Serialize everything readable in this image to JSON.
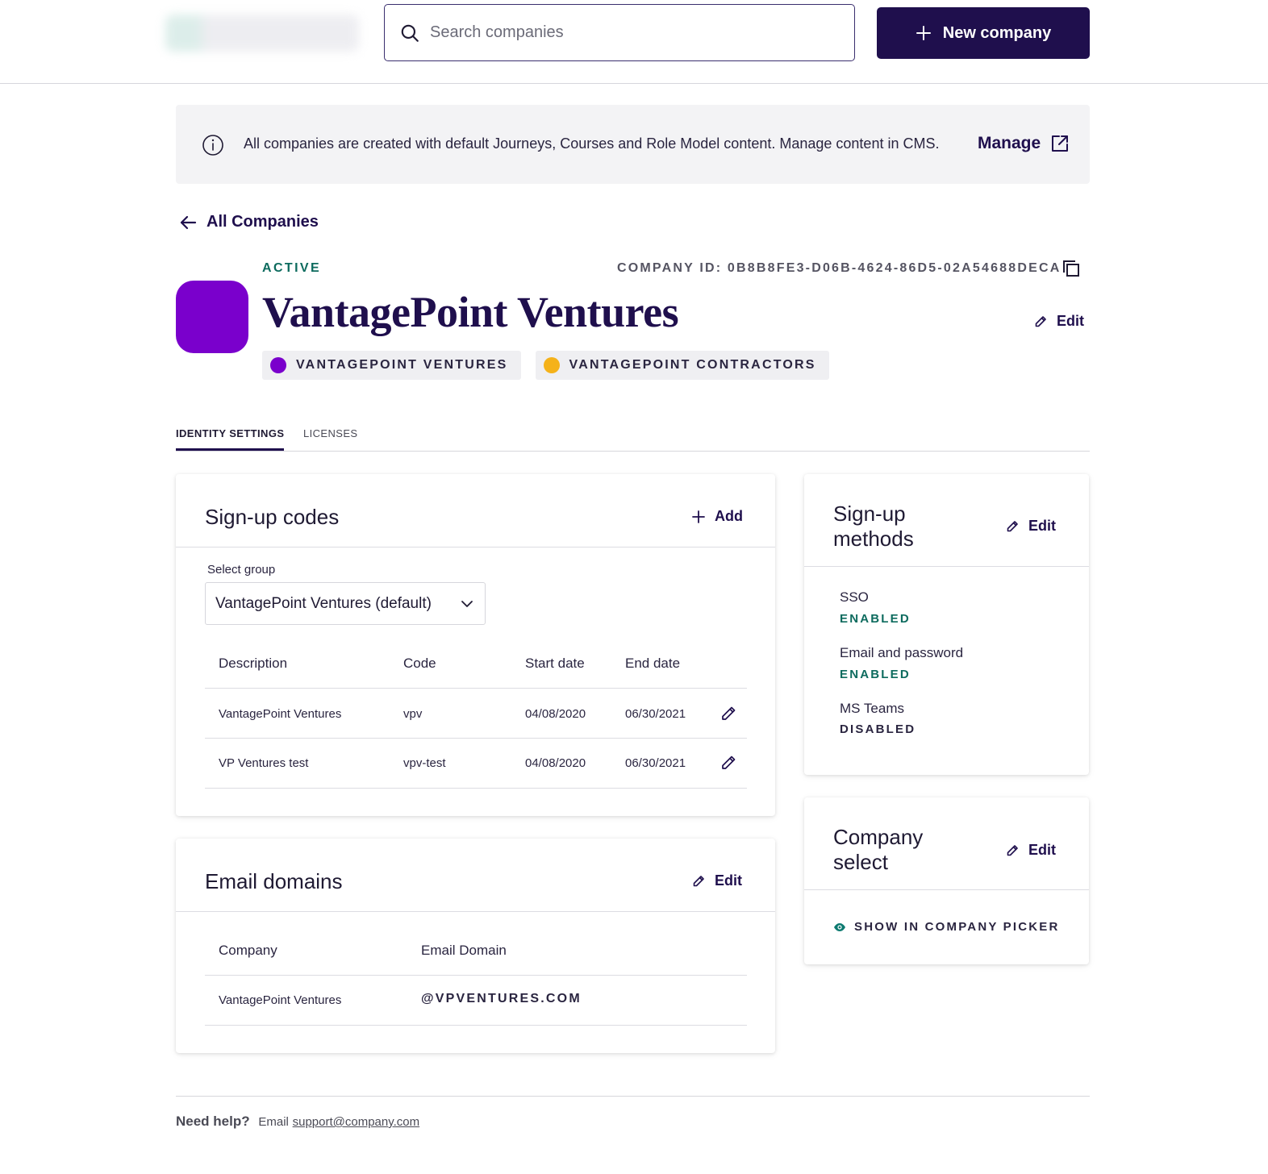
{
  "header": {
    "search_placeholder": "Search companies",
    "new_company_label": "New company"
  },
  "banner": {
    "message": "All companies are created with default Journeys, Courses and Role Model content. Manage content in CMS.",
    "manage_label": "Manage"
  },
  "nav": {
    "back_label": "All Companies"
  },
  "company": {
    "status": "ACTIVE",
    "id_label": "COMPANY ID: 0B8B8FE3-D06B-4624-86D5-02A54688DECA",
    "name": "VantagePoint Ventures",
    "edit_label": "Edit",
    "avatar_color": "#7a00cc",
    "groups": [
      {
        "label": "VANTAGEPOINT VENTURES",
        "color": "#7a00cc"
      },
      {
        "label": "VANTAGEPOINT CONTRACTORS",
        "color": "#f5b21a"
      }
    ]
  },
  "tabs": [
    {
      "label": "IDENTITY SETTINGS",
      "active": true
    },
    {
      "label": "LICENSES",
      "active": false
    }
  ],
  "signup_codes": {
    "title": "Sign-up codes",
    "add_label": "Add",
    "select_label": "Select group",
    "select_value": "VantagePoint Ventures (default)",
    "columns": [
      "Description",
      "Code",
      "Start date",
      "End date"
    ],
    "rows": [
      {
        "description": "VantagePoint Ventures",
        "code": "vpv",
        "start": "04/08/2020",
        "end": "06/30/2021"
      },
      {
        "description": "VP Ventures test",
        "code": "vpv-test",
        "start": "04/08/2020",
        "end": "06/30/2021"
      }
    ]
  },
  "email_domains": {
    "title": "Email domains",
    "edit_label": "Edit",
    "columns": [
      "Company",
      "Email Domain"
    ],
    "rows": [
      {
        "company": "VantagePoint Ventures",
        "domain": "@VPVENTURES.COM"
      }
    ]
  },
  "signup_methods": {
    "title_line1": "Sign-up",
    "title_line2": "methods",
    "edit_label": "Edit",
    "methods": [
      {
        "name": "SSO",
        "status": "ENABLED",
        "color": "#0d6b5e"
      },
      {
        "name": "Email and password",
        "status": "ENABLED",
        "color": "#0d6b5e"
      },
      {
        "name": "MS Teams",
        "status": "DISABLED",
        "color": "#2a2540"
      }
    ]
  },
  "company_select": {
    "title_line1": "Company",
    "title_line2": "select",
    "edit_label": "Edit",
    "picker_label": "SHOW IN COMPANY PICKER",
    "accent": "#0d7a70"
  },
  "footer": {
    "help_label": "Need help?",
    "email_label": "Email",
    "email_link": "support@company.com"
  }
}
